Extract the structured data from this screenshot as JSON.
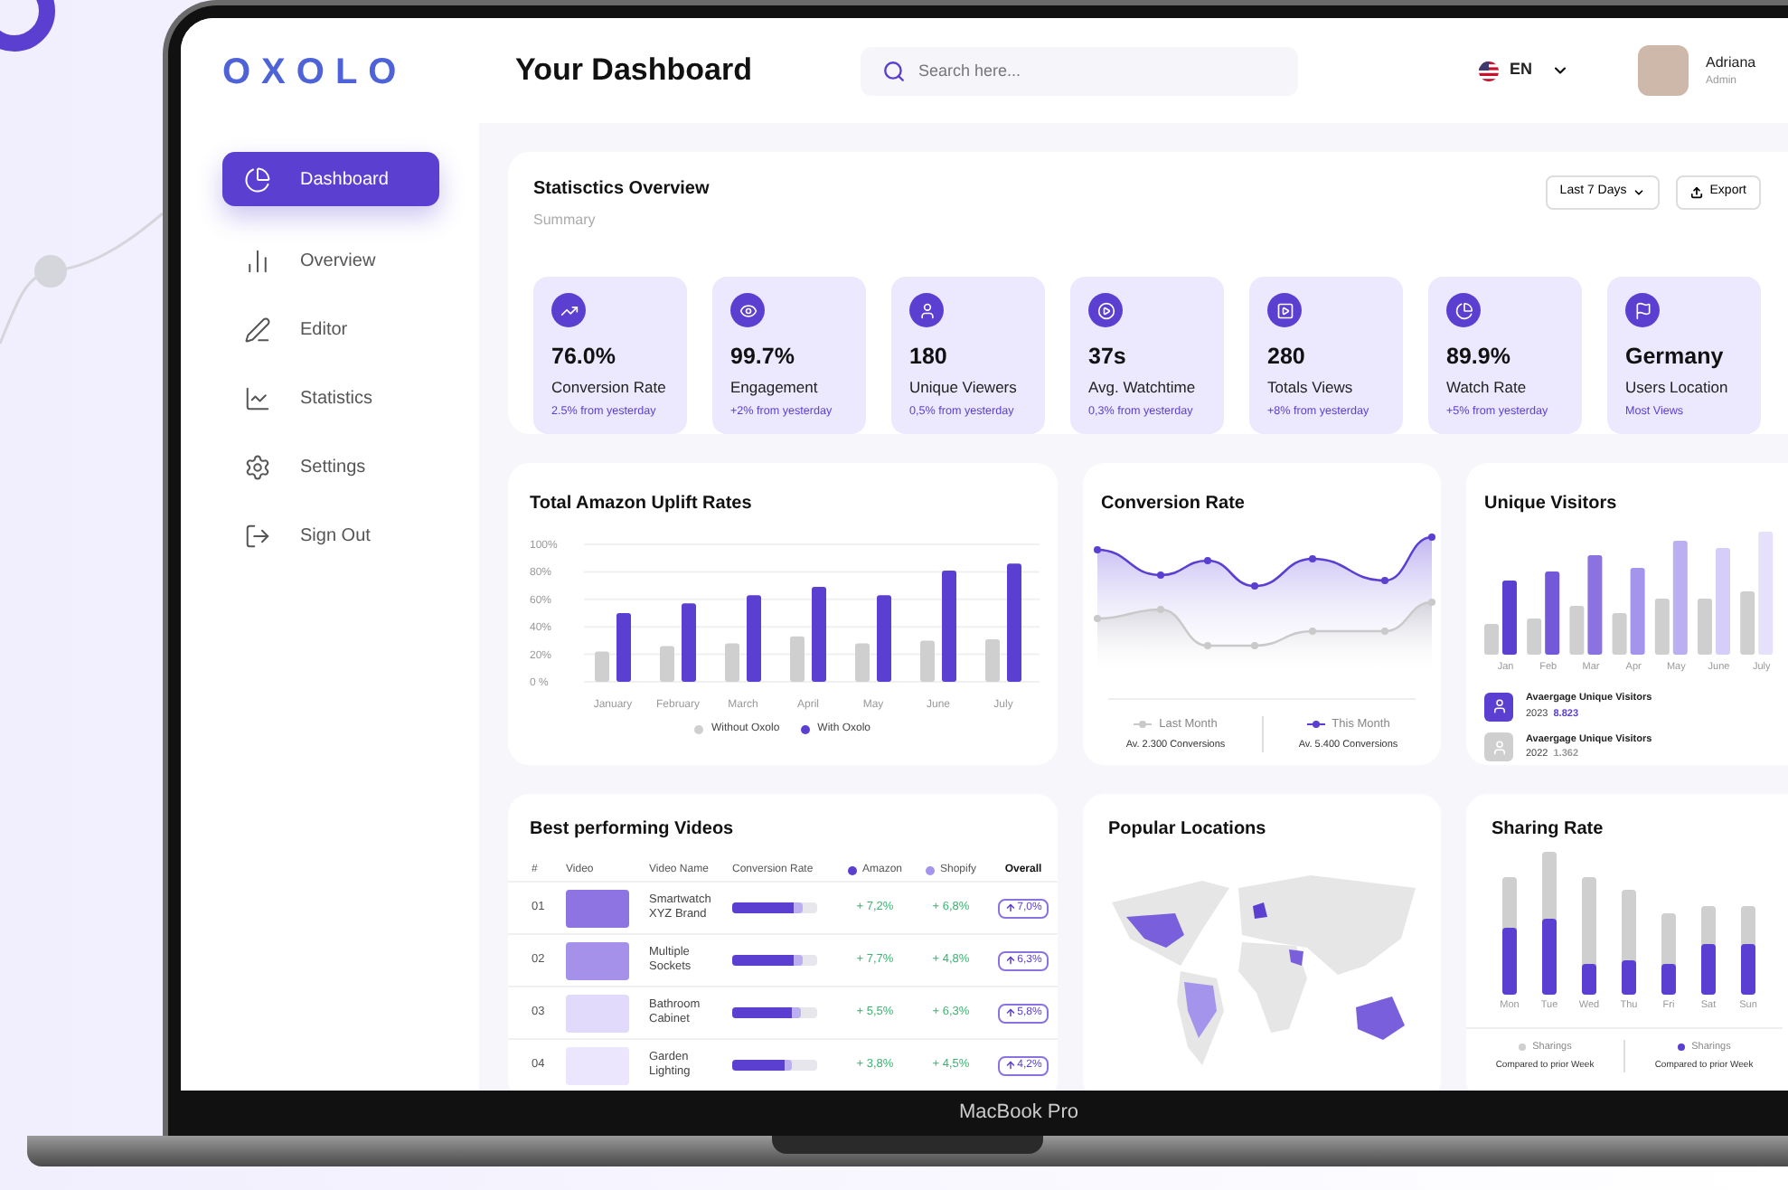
{
  "sidebar": {
    "logo": "OXOLO",
    "items": [
      {
        "label": "Dashboard",
        "selected": true
      },
      {
        "label": "Overview",
        "selected": false
      },
      {
        "label": "Editor",
        "selected": false
      },
      {
        "label": "Statistics",
        "selected": false
      },
      {
        "label": "Settings",
        "selected": false
      },
      {
        "label": "Sign Out",
        "selected": false
      }
    ]
  },
  "header": {
    "title": "Your Dashboard",
    "search": {
      "placeholder": "Search here..."
    },
    "language": "EN",
    "user": {
      "name": "Adriana",
      "role": "Admin"
    }
  },
  "overview": {
    "title": "Statisctics Overview",
    "subtitle": "Summary",
    "range": "Last 7 Days",
    "export": "Export",
    "stats": [
      {
        "value": "76.0%",
        "label": "Conversion Rate",
        "change": "2.5% from yesterday"
      },
      {
        "value": "99.7%",
        "label": "Engagement",
        "change": "+2% from yesterday"
      },
      {
        "value": "180",
        "label": "Unique Viewers",
        "change": "0,5% from yesterday"
      },
      {
        "value": "37s",
        "label": "Avg. Watchtime",
        "change": "0,3% from yesterday"
      },
      {
        "value": "280",
        "label": "Totals Views",
        "change": "+8% from yesterday"
      },
      {
        "value": "89.9%",
        "label": "Watch Rate",
        "change": "+5% from yesterday"
      },
      {
        "value": "Germany",
        "label": "Users Location",
        "change": "Most Views"
      }
    ]
  },
  "uplift": {
    "title": "Total Amazon Uplift Rates",
    "chart_data": {
      "type": "bar",
      "categories": [
        "January",
        "February",
        "March",
        "April",
        "May",
        "June",
        "July"
      ],
      "series": [
        {
          "name": "Without Oxolo",
          "color": "#cfcfcf",
          "values": [
            22,
            26,
            28,
            33,
            28,
            30,
            31
          ]
        },
        {
          "name": "With Oxolo",
          "color": "#5b3fd1",
          "values": [
            50,
            57,
            63,
            69,
            63,
            81,
            86
          ]
        }
      ],
      "grid": true,
      "ylim": [
        0,
        100
      ],
      "yticks": [
        {
          "value": 0,
          "label": "0 %"
        },
        {
          "value": 20,
          "label": "20%"
        },
        {
          "value": 40,
          "label": "40%"
        },
        {
          "value": 60,
          "label": "60%"
        },
        {
          "value": 80,
          "label": "80%"
        },
        {
          "value": 100,
          "label": "100%"
        }
      ]
    }
  },
  "conversion": {
    "title": "Conversion Rate",
    "legend": [
      {
        "label": "Last Month",
        "note": "Av. 2.300 Conversions",
        "color": "#c9c9c9"
      },
      {
        "label": "This Month",
        "note": "Av. 5.400 Conversions",
        "color": "#5b3fd1"
      }
    ]
  },
  "visitors": {
    "title": "Unique Visitors",
    "months": [
      "Jan",
      "Feb",
      "Mar",
      "Apr",
      "May",
      "June",
      "July"
    ],
    "summary": [
      {
        "label": "Avaergage Unique Visitors",
        "year": "2023",
        "value": "8.823",
        "color": "#5b3fd1"
      },
      {
        "label": "Avaergage Unique Visitors",
        "year": "2022",
        "value": "1.362",
        "color": "#cfcfcf"
      }
    ]
  },
  "videos": {
    "title": "Best performing Videos",
    "columns": [
      {
        "label": "#"
      },
      {
        "label": "Video"
      },
      {
        "label": "Video Name"
      },
      {
        "label": "Conversion Rate"
      },
      {
        "label": "Amazon",
        "color": "#5b3fd1"
      },
      {
        "label": "Shopify",
        "color": "#a594ec"
      },
      {
        "label": "Overall"
      }
    ],
    "rows": [
      {
        "number": "01",
        "name": "Smartwatch XYZ Brand",
        "level": 0.73,
        "amazon": "+ 7,2%",
        "shopify": "+ 6,8%",
        "overall": "7,0%"
      },
      {
        "number": "02",
        "name": "Multiple Sockets",
        "level": 0.73,
        "amazon": "+ 7,7%",
        "shopify": "+ 4,8%",
        "overall": "6,3%"
      },
      {
        "number": "03",
        "name": "Bathroom Cabinet",
        "level": 0.7,
        "amazon": "+ 5,5%",
        "shopify": "+ 6,3%",
        "overall": "5,8%"
      },
      {
        "number": "04",
        "name": "Garden Lighting",
        "level": 0.61,
        "amazon": "+ 3,8%",
        "shopify": "+ 4,5%",
        "overall": "4,2%"
      }
    ]
  },
  "locations": {
    "title": "Popular Locations"
  },
  "sharing": {
    "title": "Sharing Rate",
    "days": [
      "Mon",
      "Tue",
      "Wed",
      "Thu",
      "Fri",
      "Sat",
      "Sun"
    ],
    "legend": [
      {
        "label": "Sharings",
        "note": "Compared to prior Week",
        "color": "#cfcfcf"
      },
      {
        "label": "Sharings",
        "note": "Compared to prior Week",
        "color": "#5b3fd1"
      }
    ]
  },
  "device": {
    "label": "MacBook Pro"
  }
}
